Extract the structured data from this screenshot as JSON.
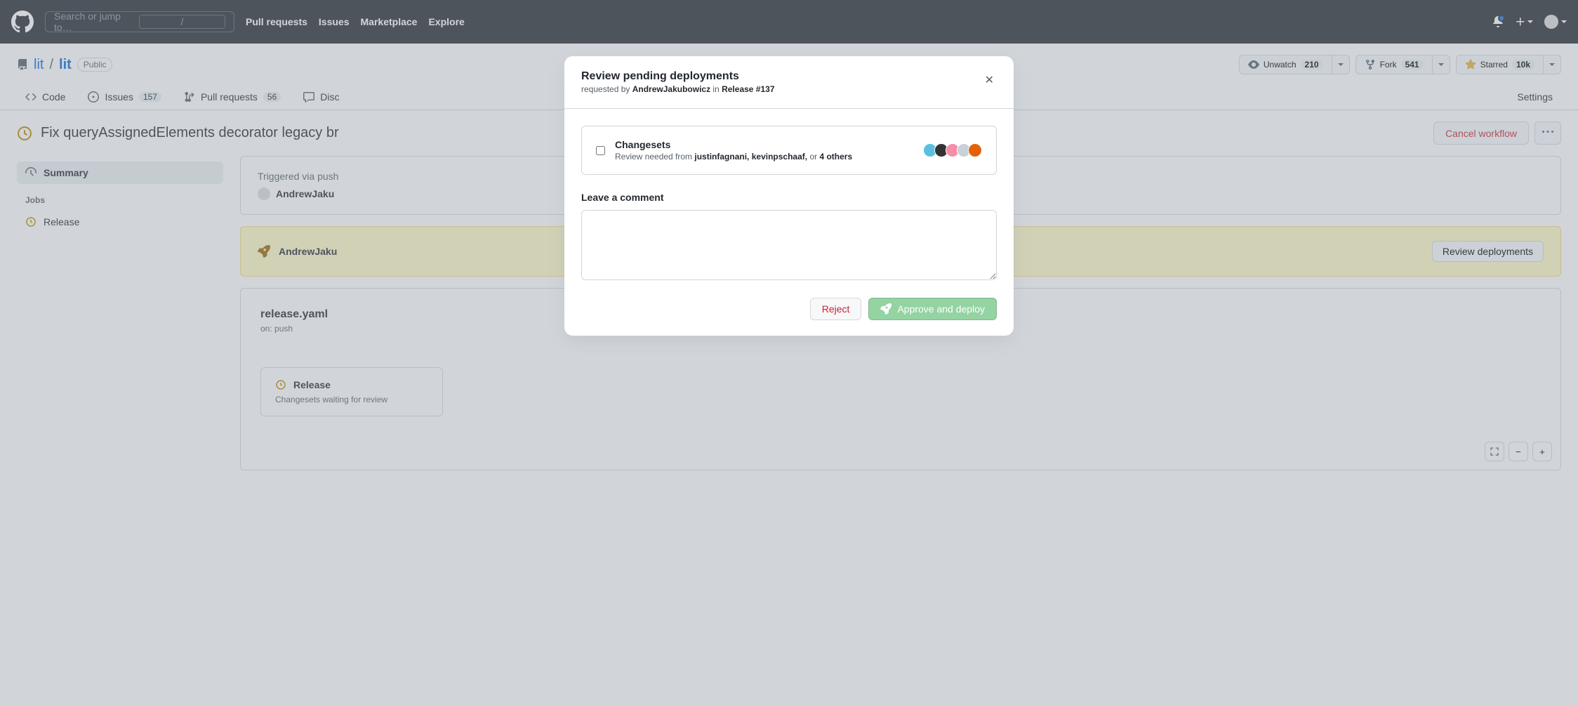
{
  "header": {
    "search_placeholder": "Search or jump to…",
    "slash": "/",
    "nav": {
      "pull": "Pull requests",
      "issues": "Issues",
      "market": "Marketplace",
      "explore": "Explore"
    }
  },
  "repo": {
    "owner": "lit",
    "name": "lit",
    "sep": "/",
    "visibility": "Public",
    "unwatch": "Unwatch",
    "unwatch_count": "210",
    "fork": "Fork",
    "fork_count": "541",
    "starred": "Starred",
    "star_count": "10k"
  },
  "tabs": {
    "code": "Code",
    "issues": "Issues",
    "issues_count": "157",
    "pulls": "Pull requests",
    "pulls_count": "56",
    "discussions": "Disc",
    "settings": "Settings"
  },
  "workflow": {
    "title": "Fix queryAssignedElements decorator legacy br",
    "cancel": "Cancel workflow"
  },
  "sidebar": {
    "summary": "Summary",
    "jobs_label": "Jobs",
    "job1": "Release"
  },
  "trigger": {
    "text": "Triggered via push",
    "user": "AndrewJaku"
  },
  "banner": {
    "user": "AndrewJaku",
    "button": "Review deployments"
  },
  "wf": {
    "file": "release.yaml",
    "on": "on: push",
    "job_name": "Release",
    "job_env": "Changesets",
    "job_status": "waiting for review"
  },
  "modal": {
    "title": "Review pending deployments",
    "sub_prefix": "requested by ",
    "sub_user": "AndrewJakubowicz",
    "sub_mid": " in ",
    "sub_link": "Release #137",
    "env_name": "Changesets",
    "env_prefix": "Review needed from ",
    "env_rev1": "justinfagnani, kevinpschaaf,",
    "env_or": " or ",
    "env_rev2": "4 others",
    "comment_label": "Leave a comment",
    "reject": "Reject",
    "approve": "Approve and deploy"
  },
  "avatar_colors": [
    "#5bc0de",
    "#333",
    "#f78da7",
    "#c8d1d9",
    "#e36209"
  ]
}
